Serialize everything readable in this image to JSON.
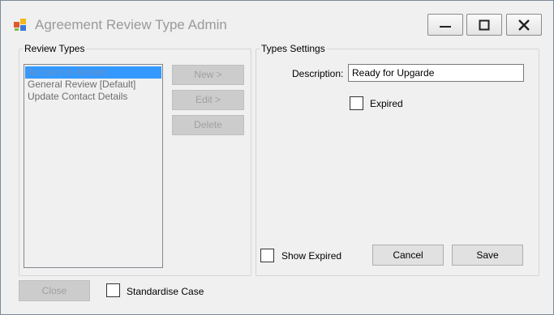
{
  "window": {
    "title": "Agreement Review Type Admin",
    "icons": {
      "app": "app-icon",
      "minimize": "minimize-icon",
      "maximize": "maximize-icon",
      "close": "close-icon"
    }
  },
  "review_types": {
    "legend": "Review Types",
    "items": [
      "Account in Arrears",
      "General Review [Default]",
      "Update Contact Details"
    ],
    "selected_index": 0,
    "new_label": "New >",
    "edit_label": "Edit >",
    "delete_label": "Delete"
  },
  "settings": {
    "legend": "Types Settings",
    "description_label": "Description:",
    "description_value": "Ready for Upgarde",
    "expired_label": "Expired",
    "expired_checked": false
  },
  "footer": {
    "show_expired_label": "Show Expired",
    "cancel_label": "Cancel",
    "save_label": "Save",
    "close_label": "Close",
    "standardise_case_label": "Standardise Case"
  },
  "colors": {
    "selection": "#3399ff",
    "window_bg": "#f0f0f0"
  }
}
